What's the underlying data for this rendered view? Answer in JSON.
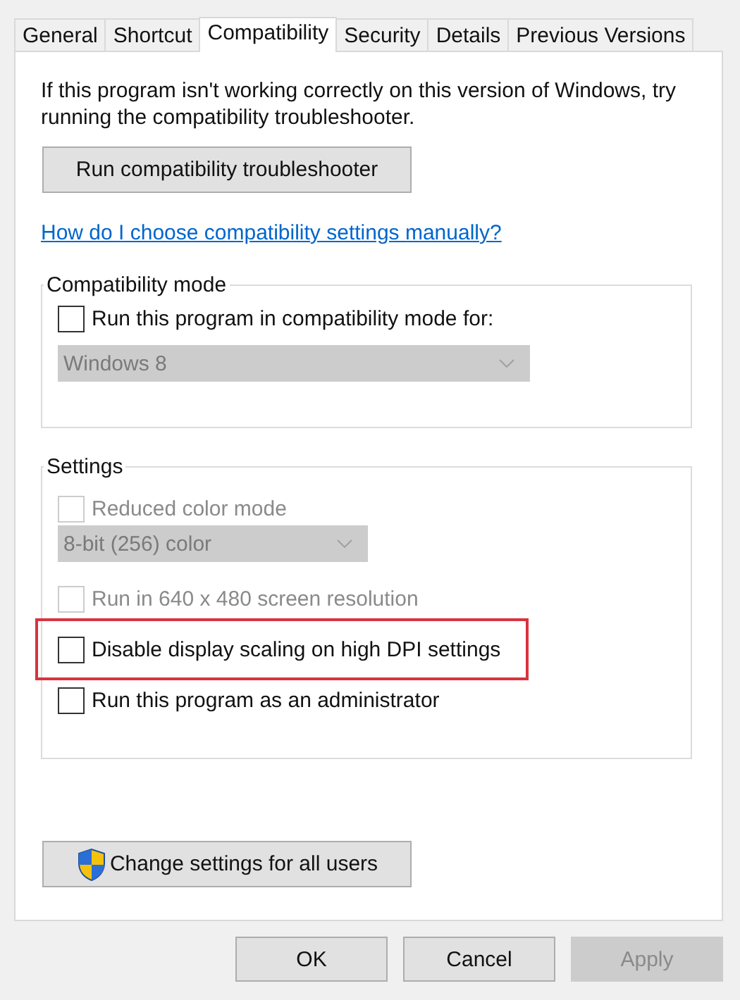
{
  "tabs": [
    {
      "label": "General",
      "selected": false
    },
    {
      "label": "Shortcut",
      "selected": false
    },
    {
      "label": "Compatibility",
      "selected": true
    },
    {
      "label": "Security",
      "selected": false
    },
    {
      "label": "Details",
      "selected": false
    },
    {
      "label": "Previous Versions",
      "selected": false
    }
  ],
  "intro": "If this program isn't working correctly on this version of Windows, try running the compatibility troubleshooter.",
  "troubleshooter_button": "Run compatibility troubleshooter",
  "help_link": "How do I choose compatibility settings manually?",
  "compatibility_mode": {
    "title": "Compatibility mode",
    "items": [
      {
        "kind": "checkbox",
        "label": "Run this program in compatibility mode for:",
        "checked": false,
        "disabled": false,
        "highlighted": false
      },
      {
        "kind": "dropdown",
        "value": "Windows 8",
        "disabled": true
      }
    ]
  },
  "settings": {
    "title": "Settings",
    "items": [
      {
        "kind": "checkbox",
        "label": "Reduced color mode",
        "checked": false,
        "disabled": true,
        "highlighted": false
      },
      {
        "kind": "dropdown",
        "value": "8-bit (256) color",
        "disabled": true
      },
      {
        "kind": "checkbox",
        "label": "Run in 640 x 480 screen resolution",
        "checked": false,
        "disabled": true,
        "highlighted": false
      },
      {
        "kind": "checkbox",
        "label": "Disable display scaling on high DPI settings",
        "checked": false,
        "disabled": false,
        "highlighted": true
      },
      {
        "kind": "checkbox",
        "label": "Run this program as an administrator",
        "checked": false,
        "disabled": false,
        "highlighted": false
      }
    ]
  },
  "change_settings_button": "Change settings for all users",
  "dialog_buttons": [
    {
      "label": "OK",
      "disabled": false
    },
    {
      "label": "Cancel",
      "disabled": false
    },
    {
      "label": "Apply",
      "disabled": true
    }
  ]
}
